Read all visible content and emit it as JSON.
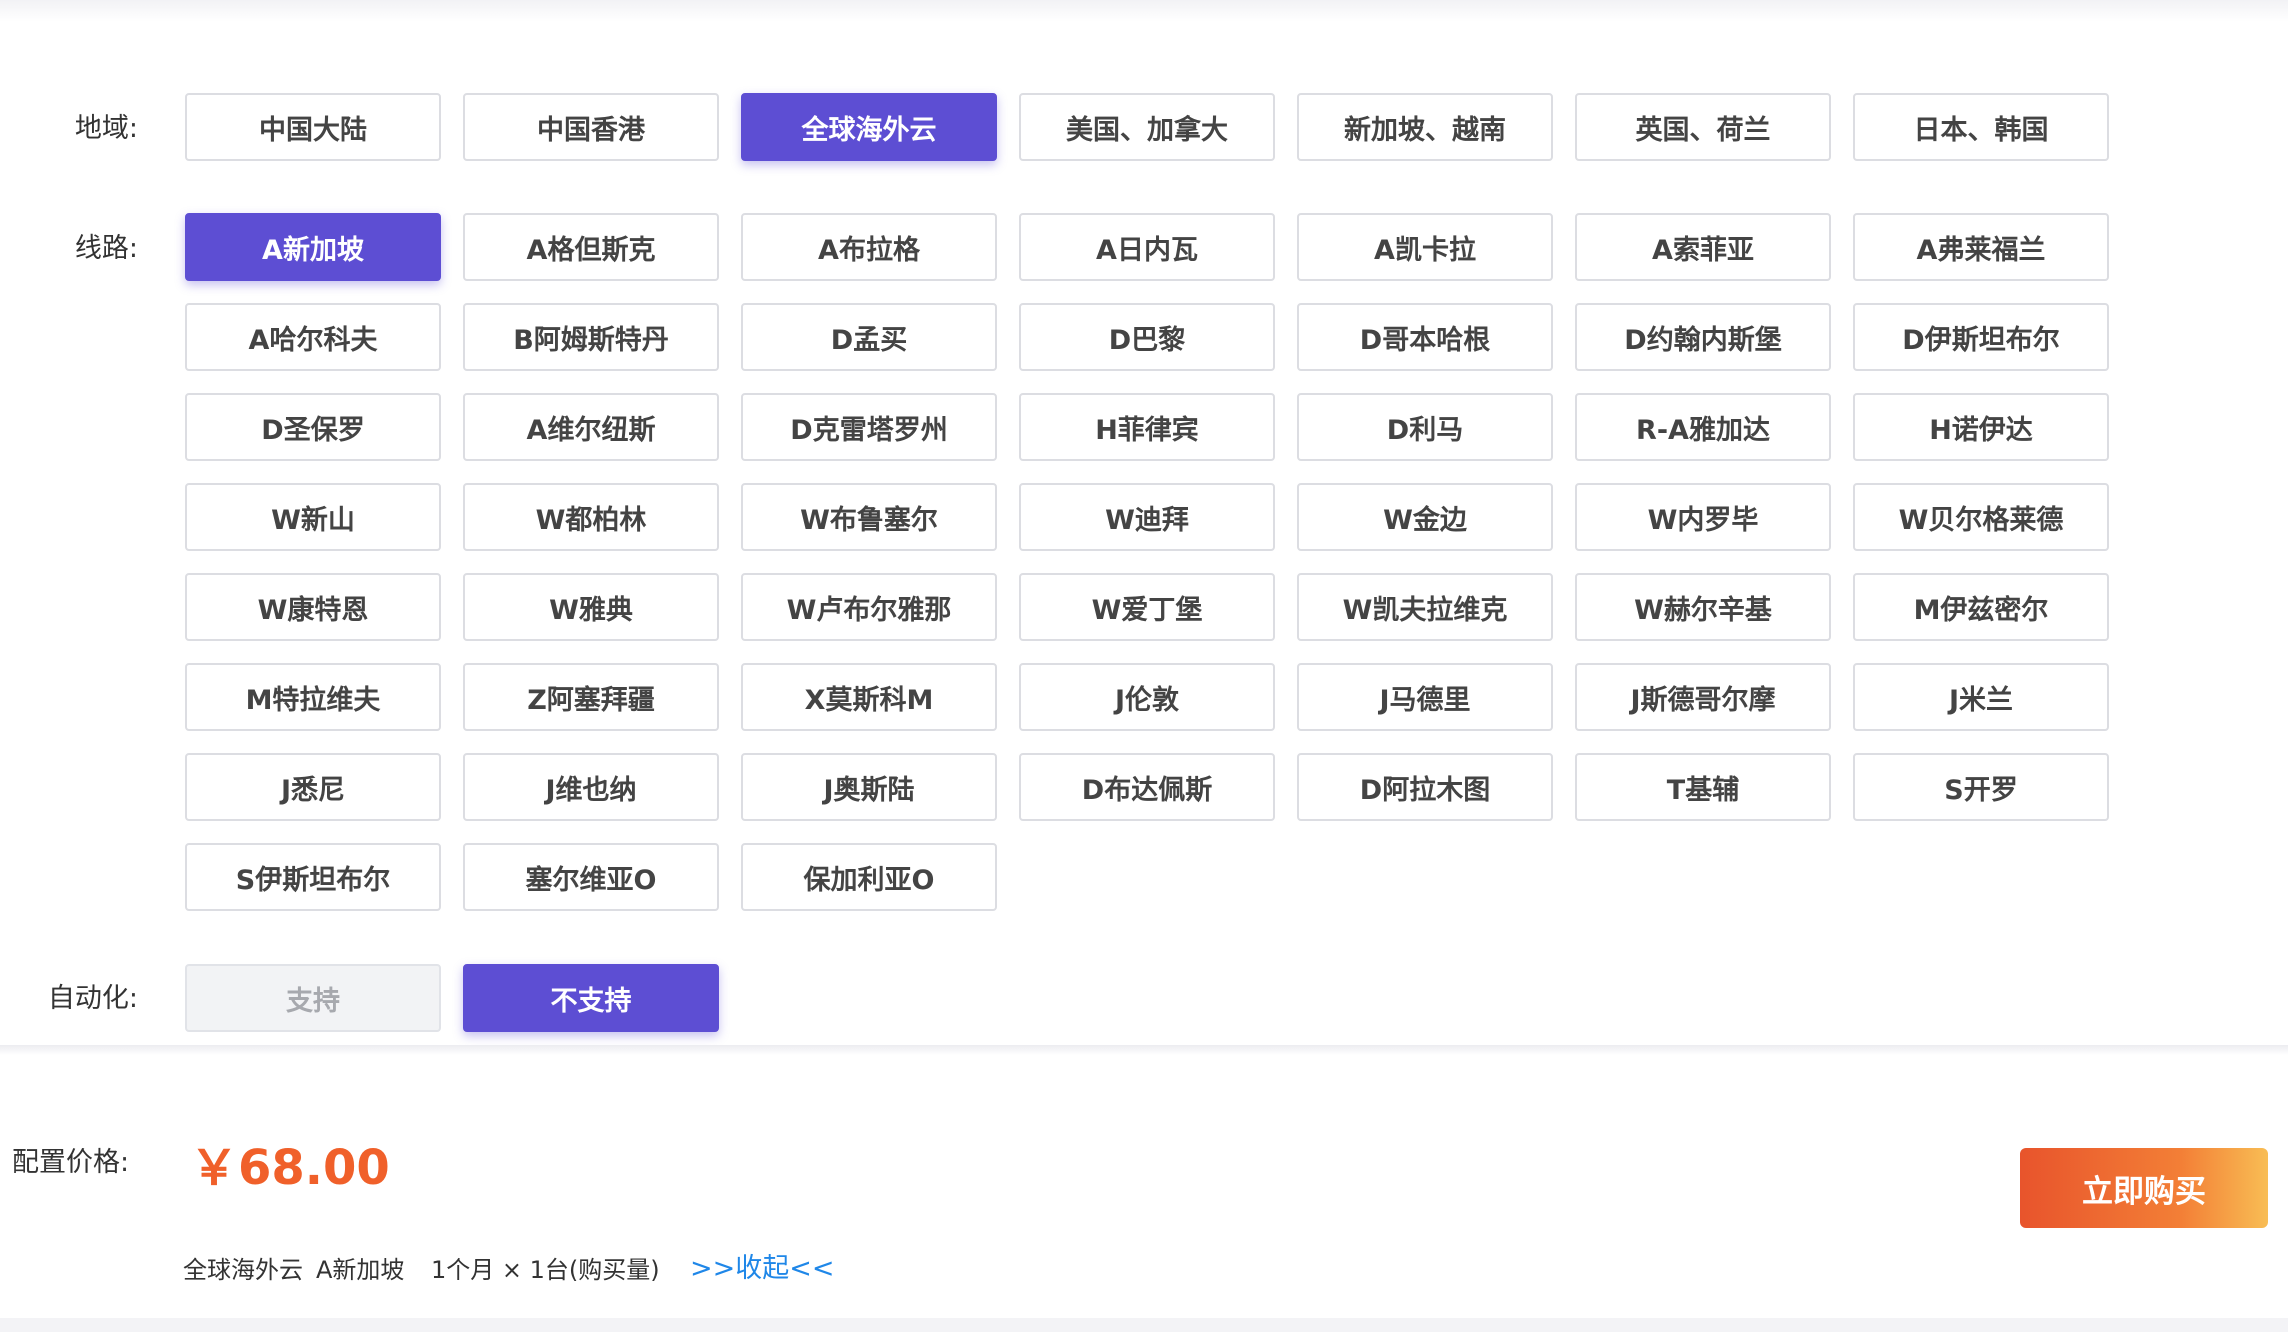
{
  "region": {
    "label": "地域:",
    "options": [
      "中国大陆",
      "中国香港",
      "全球海外云",
      "美国、加拿大",
      "新加坡、越南",
      "英国、荷兰",
      "日本、韩国"
    ],
    "selected_index": 2
  },
  "route": {
    "label": "线路:",
    "options": [
      "A新加坡",
      "A格但斯克",
      "A布拉格",
      "A日内瓦",
      "A凯卡拉",
      "A索菲亚",
      "A弗莱福兰",
      "A哈尔科夫",
      "B阿姆斯特丹",
      "D孟买",
      "D巴黎",
      "D哥本哈根",
      "D约翰内斯堡",
      "D伊斯坦布尔",
      "D圣保罗",
      "A维尔纽斯",
      "D克雷塔罗州",
      "H菲律宾",
      "D利马",
      "R-A雅加达",
      "H诺伊达",
      "W新山",
      "W都柏林",
      "W布鲁塞尔",
      "W迪拜",
      "W金边",
      "W内罗毕",
      "W贝尔格莱德",
      "W康特恩",
      "W雅典",
      "W卢布尔雅那",
      "W爱丁堡",
      "W凯夫拉维克",
      "W赫尔辛基",
      "M伊兹密尔",
      "M特拉维夫",
      "Z阿塞拜疆",
      "X莫斯科M",
      "J伦敦",
      "J马德里",
      "J斯德哥尔摩",
      "J米兰",
      "J悉尼",
      "J维也纳",
      "J奥斯陆",
      "D布达佩斯",
      "D阿拉木图",
      "T基辅",
      "S开罗",
      "S伊斯坦布尔",
      "塞尔维亚O",
      "保加利亚O"
    ],
    "selected_index": 0
  },
  "automation": {
    "label": "自动化:",
    "options": [
      "支持",
      "不支持"
    ],
    "selected_index": 1,
    "disabled_index": 0
  },
  "price": {
    "label": "配置价格:",
    "value": "￥68.00"
  },
  "summary": {
    "region": "全球海外云",
    "route": "A新加坡",
    "quantity": "1个月 × 1台(购买量)",
    "collapse_label": ">>收起<<"
  },
  "buy_button": "立即购买",
  "colors": {
    "accent": "#5d4ed3",
    "price": "#f0602a",
    "link": "#1f87e8"
  }
}
